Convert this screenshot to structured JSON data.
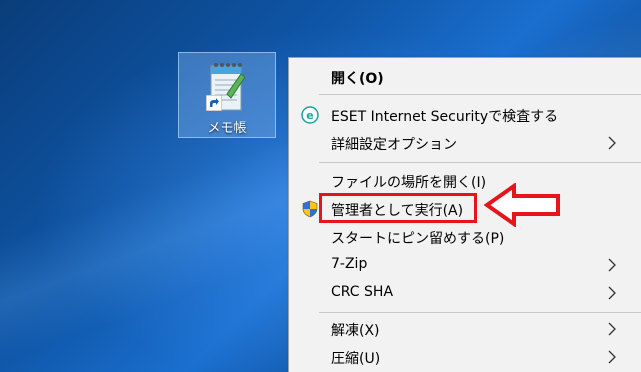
{
  "desktop": {
    "icon_label": "メモ帳",
    "icon_name": "notepad-icon"
  },
  "context_menu": {
    "items": [
      {
        "label": "開く(O)",
        "bold": true
      },
      {
        "label": "ESET Internet Securityで検査する",
        "icon": "eset-icon"
      },
      {
        "label": "詳細設定オプション",
        "submenu": true
      },
      {
        "label": "ファイルの場所を開く(I)"
      },
      {
        "label": "管理者として実行(A)",
        "icon": "uac-shield-icon"
      },
      {
        "label": "スタートにピン留めする(P)"
      },
      {
        "label": "7-Zip",
        "submenu": true
      },
      {
        "label": "CRC SHA",
        "submenu": true
      },
      {
        "label": "解凍(X)",
        "submenu": true
      },
      {
        "label": "圧縮(U)",
        "submenu": true
      }
    ]
  },
  "annotation": {
    "highlight_color": "#e8141c",
    "target": "管理者として実行(A)"
  },
  "colors": {
    "menu_background": "#f2f2f2",
    "desktop_selection": "#78aae6",
    "accent_red": "#e8141c"
  }
}
